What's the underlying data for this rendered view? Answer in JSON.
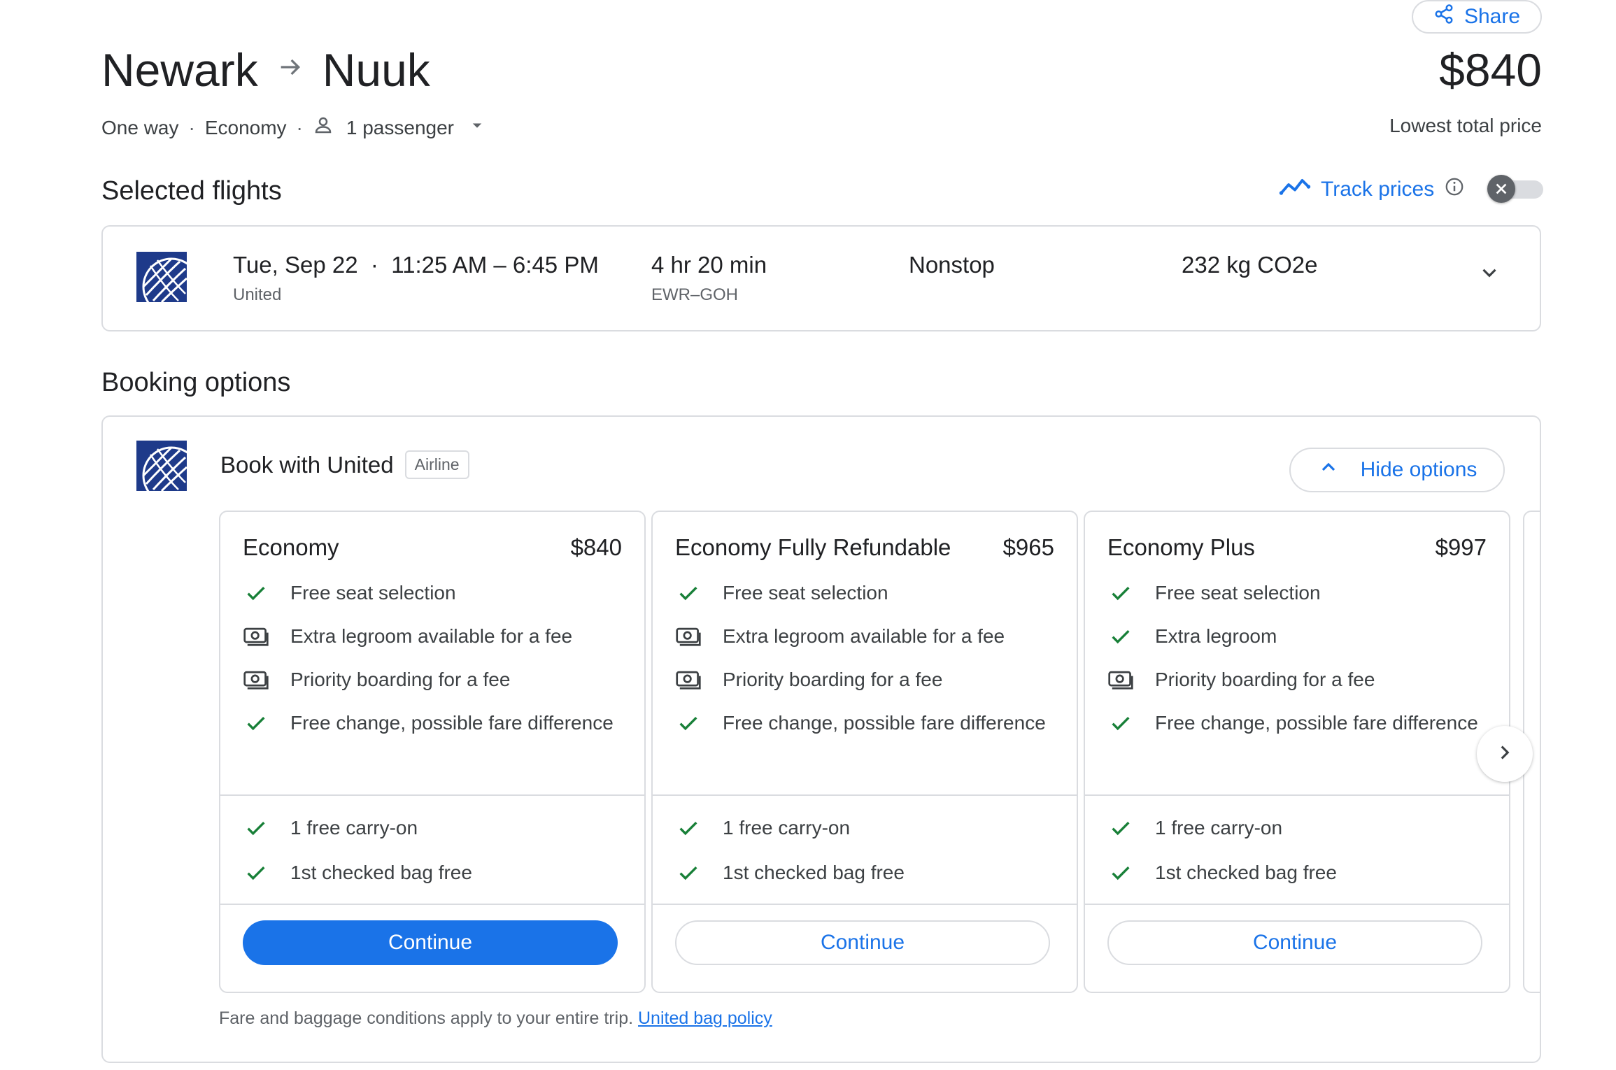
{
  "header": {
    "share_label": "Share",
    "origin": "Newark",
    "destination": "Nuuk",
    "price": "$840",
    "price_caption": "Lowest total price",
    "trip_type": "One way",
    "cabin": "Economy",
    "passengers": "1 passenger"
  },
  "selected": {
    "title": "Selected flights",
    "track_label": "Track prices",
    "flight": {
      "date": "Tue, Sep 22",
      "times": "11:25 AM – 6:45 PM",
      "airline": "United",
      "duration": "4 hr 20 min",
      "airports": "EWR–GOH",
      "stops": "Nonstop",
      "emissions": "232 kg CO2e"
    }
  },
  "booking": {
    "title": "Booking options",
    "provider": "Book with United",
    "provider_badge": "Airline",
    "hide_label": "Hide options",
    "note": "Fare and baggage conditions apply to your entire trip.",
    "policy_link": "United bag policy",
    "fares": [
      {
        "name": "Economy",
        "price": "$840",
        "features": [
          {
            "icon": "check-icon",
            "text": "Free seat selection"
          },
          {
            "icon": "money-icon",
            "text": "Extra legroom available for a fee"
          },
          {
            "icon": "money-icon",
            "text": "Priority boarding for a fee"
          },
          {
            "icon": "check-icon",
            "text": "Free change, possible fare difference"
          }
        ],
        "bags": [
          "1 free carry-on",
          "1st checked bag free"
        ],
        "cta": "Continue",
        "primary": true
      },
      {
        "name": "Economy Fully Refundable",
        "price": "$965",
        "features": [
          {
            "icon": "check-icon",
            "text": "Free seat selection"
          },
          {
            "icon": "money-icon",
            "text": "Extra legroom available for a fee"
          },
          {
            "icon": "money-icon",
            "text": "Priority boarding for a fee"
          },
          {
            "icon": "check-icon",
            "text": "Free change, possible fare difference"
          }
        ],
        "bags": [
          "1 free carry-on",
          "1st checked bag free"
        ],
        "cta": "Continue",
        "primary": false
      },
      {
        "name": "Economy Plus",
        "price": "$997",
        "features": [
          {
            "icon": "check-icon",
            "text": "Free seat selection"
          },
          {
            "icon": "check-icon",
            "text": "Extra legroom"
          },
          {
            "icon": "money-icon",
            "text": "Priority boarding for a fee"
          },
          {
            "icon": "check-icon",
            "text": "Free change, possible fare difference"
          }
        ],
        "bags": [
          "1 free carry-on",
          "1st checked bag free"
        ],
        "cta": "Continue",
        "primary": false
      }
    ]
  },
  "colors": {
    "accent": "#1a73e8",
    "check": "#188038",
    "border": "#dadce0",
    "airline_logo": "#1e3a8a"
  }
}
